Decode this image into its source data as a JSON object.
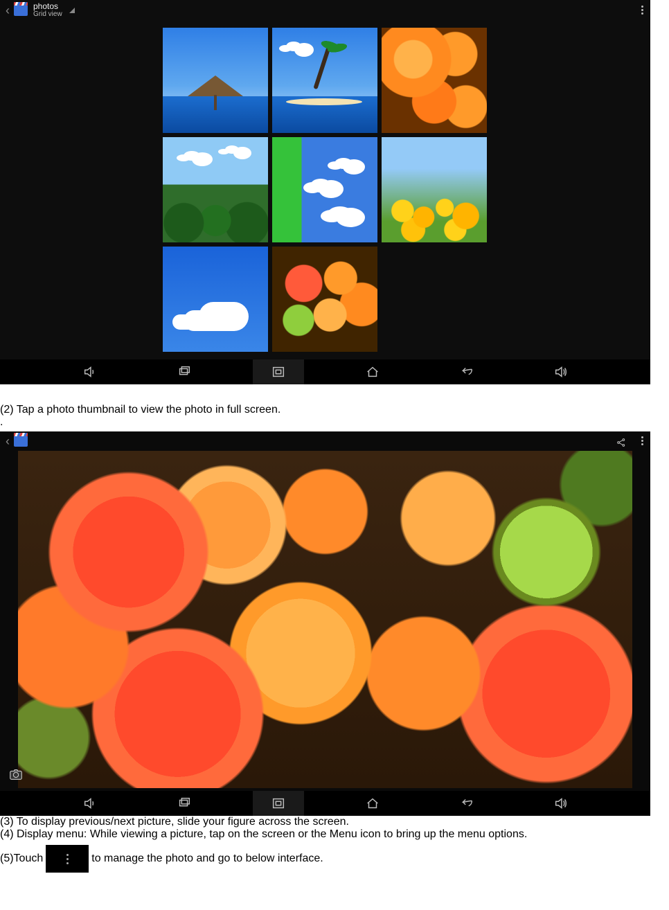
{
  "screenshot1": {
    "topbar": {
      "title": "photos",
      "subtitle": "Grid view"
    }
  },
  "text": {
    "step2": "(2) Tap a photo thumbnail to view the photo in full screen.",
    "dot": ".",
    "step3": "(3) To display previous/next picture, slide your figure across the screen.",
    "step4": "(4) Display menu: While viewing a picture, tap on the screen or the Menu icon to bring up the menu options.",
    "step5_a": "(5)Touch",
    "step5_b": " to manage the photo and go to below interface."
  }
}
